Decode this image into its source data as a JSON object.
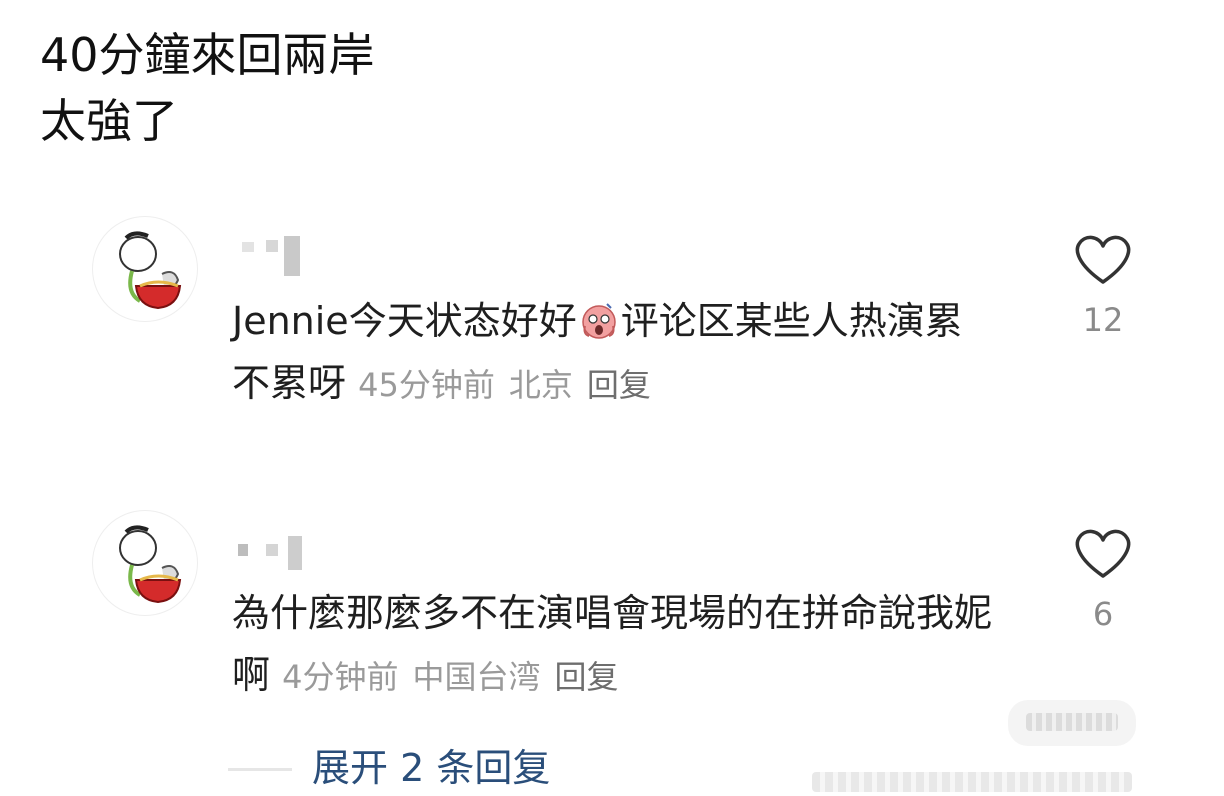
{
  "post": {
    "line1": "40分鐘來回兩岸",
    "line2": "太強了"
  },
  "comments": [
    {
      "text_part1": "Jennie今天状态好好",
      "emoji": "scream-emoji",
      "text_part2": "评论区某些人热演累不累呀",
      "time": "45分钟前",
      "location": "北京",
      "reply": "回复",
      "likes": "12"
    },
    {
      "text": "為什麼那麼多不在演唱會現場的在拼命說我妮啊",
      "time": "4分钟前",
      "location": "中国台湾",
      "reply": "回复",
      "likes": "6"
    }
  ],
  "expand": {
    "label": "展开 2 条回复"
  },
  "icons": {
    "like": "heart-outline-icon",
    "avatar": "cartoon-avatar"
  },
  "colors": {
    "link": "#2a4e7a",
    "meta": "#9a9a9a",
    "text": "#1f1f1f"
  }
}
